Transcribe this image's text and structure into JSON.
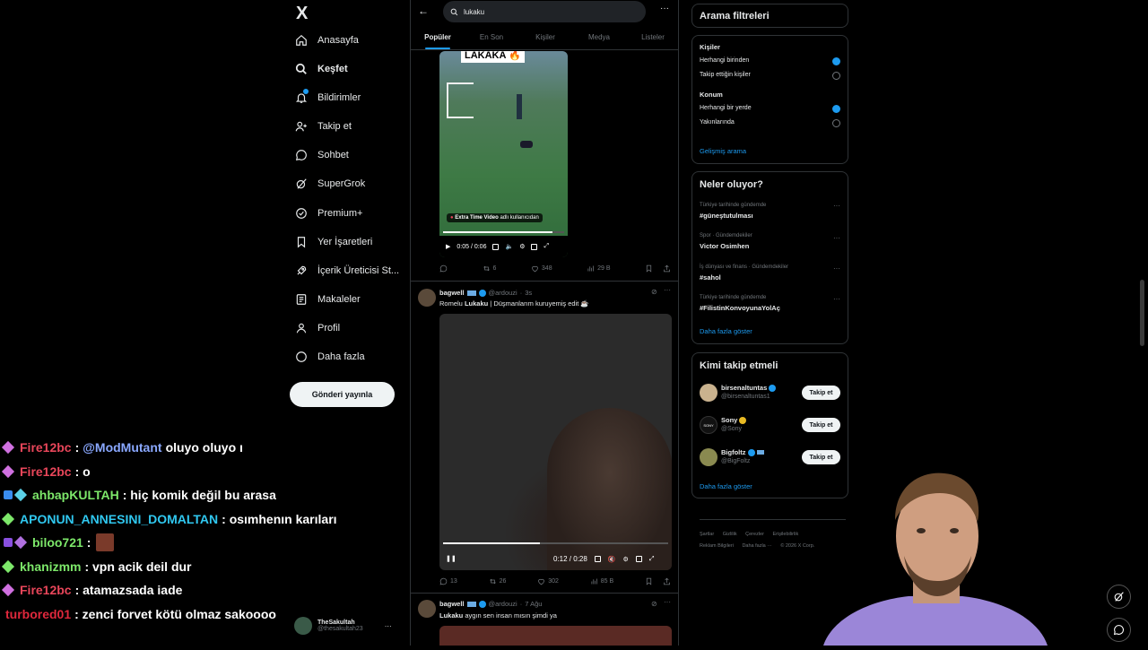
{
  "nav": {
    "logo": "X",
    "items": [
      {
        "label": "Anasayfa",
        "icon": "home-icon"
      },
      {
        "label": "Keşfet",
        "icon": "search-icon"
      },
      {
        "label": "Bildirimler",
        "icon": "bell-icon"
      },
      {
        "label": "Takip et",
        "icon": "person-add-icon"
      },
      {
        "label": "Sohbet",
        "icon": "chat-icon"
      },
      {
        "label": "SuperGrok",
        "icon": "grok-icon"
      },
      {
        "label": "Premium+",
        "icon": "premium-icon"
      },
      {
        "label": "Yer İşaretleri",
        "icon": "bookmark-icon"
      },
      {
        "label": "İçerik Üreticisi St...",
        "icon": "rocket-icon"
      },
      {
        "label": "Makaleler",
        "icon": "article-icon"
      },
      {
        "label": "Profil",
        "icon": "profile-icon"
      },
      {
        "label": "Daha fazla",
        "icon": "more-icon"
      }
    ],
    "post_button": "Gönderi yayınla"
  },
  "account": {
    "name": "TheSakultah",
    "handle": "@thesakultah23"
  },
  "chat": [
    {
      "user": "Fire12bc",
      "color": "#e8465a",
      "gem": "#d070e0",
      "msg_mention": "@ModMutant",
      "msg": "oluyo oluyo ı"
    },
    {
      "user": "Fire12bc",
      "color": "#e8465a",
      "gem": "#d070e0",
      "msg_mention": "",
      "msg": ": o"
    },
    {
      "user": "ahbapKULTAH",
      "color": "#7de86a",
      "gem": "#5bd1e8",
      "gem2": "#3a8df0",
      "msg_mention": "",
      "msg": ": hiç komik değil bu arasa"
    },
    {
      "user": "APONUN_ANNESINI_DOMALTAN",
      "color": "#30c8f0",
      "gem": "#7de86a",
      "msg_mention": "",
      "msg": ": osımhenın karıları"
    },
    {
      "user": "biloo721",
      "color": "#7de86a",
      "gem": "#b070e0",
      "gem2": "#8a50e0",
      "msg_mention": "",
      "msg": ":"
    },
    {
      "user": "khanizmm",
      "color": "#7de86a",
      "gem": "#7de86a",
      "msg_mention": "",
      "msg": ": vpn acik deil dur"
    },
    {
      "user": "Fire12bc",
      "color": "#e8465a",
      "gem": "#d070e0",
      "msg_mention": "",
      "msg": ": atamazsada iade"
    },
    {
      "user": "turbored01",
      "color": "#e0283c",
      "gem": "",
      "msg_mention": "",
      "msg": ": zenci forvet kötü olmaz sakoooo"
    }
  ],
  "search": {
    "query": "lukaku"
  },
  "tabs": [
    "Popüler",
    "En Son",
    "Kişiler",
    "Medya",
    "Listeler"
  ],
  "tweet1": {
    "video_caption": "LAKAKA 🔥",
    "attribution_bold": "Extra Time Video",
    "attribution_rest": "adlı kullanıcıdan",
    "time": "0:05 / 0:06",
    "retweets": "6",
    "likes": "348",
    "views": "29 B"
  },
  "tweet2": {
    "name": "bagwell",
    "handle": "@ardouzi",
    "time": "3s",
    "text_pre": "Romelu ",
    "text_bold": "Lukaku",
    "text_post": " | Düşmanlarım kuruyemiş edit ☕",
    "video_time": "0:12 / 0:28",
    "replies": "13",
    "retweets": "26",
    "likes": "302",
    "views": "85 B"
  },
  "tweet3": {
    "name": "bagwell",
    "handle": "@ardouzi",
    "time": "7 Ağu",
    "text_bold": "Lukaku",
    "text_post": " aygın sen insan mısın şimdi ya"
  },
  "filters": {
    "title": "Arama filtreleri",
    "people_label": "Kişiler",
    "people_options": [
      "Herhangi birinden",
      "Takip ettiğin kişiler"
    ],
    "location_label": "Konum",
    "location_options": [
      "Herhangi bir yerde",
      "Yakınlarında"
    ],
    "advanced": "Gelişmiş arama"
  },
  "trends": {
    "title": "Neler oluyor?",
    "items": [
      {
        "context": "Türkiye tarihinde gündemde",
        "name": "#güneştutulması"
      },
      {
        "context": "Spor · Gündemdekiler",
        "name": "Victor Osimhen"
      },
      {
        "context": "İş dünyası ve finans · Gündemdekiler",
        "name": "#sahol"
      },
      {
        "context": "Türkiye tarihinde gündemde",
        "name": "#FilistinKonvoyunaYolAç"
      }
    ],
    "show_more": "Daha fazla göster"
  },
  "who_to_follow": {
    "title": "Kimi takip etmeli",
    "items": [
      {
        "name": "birsenaltuntas",
        "handle": "@birsenaltuntas1",
        "avatar_color": "#c9b28e"
      },
      {
        "name": "Sony",
        "handle": "@Sony",
        "avatar_color": "#111111"
      },
      {
        "name": "Bigfoltz",
        "handle": "@BigFoltz",
        "avatar_color": "#8a8a50"
      }
    ],
    "follow_label": "Takip et",
    "show_more": "Daha fazla göster"
  },
  "footer": [
    "Şartlar",
    "Gizlilik",
    "Çerezler",
    "Erişilebilirlik",
    "Reklam Bilgileri",
    "Daha fazla ···",
    "© 2026 X Corp."
  ],
  "colors": {
    "accent": "#1d9bf0",
    "background": "#000000",
    "border": "#2f3336",
    "muted": "#71767b"
  }
}
